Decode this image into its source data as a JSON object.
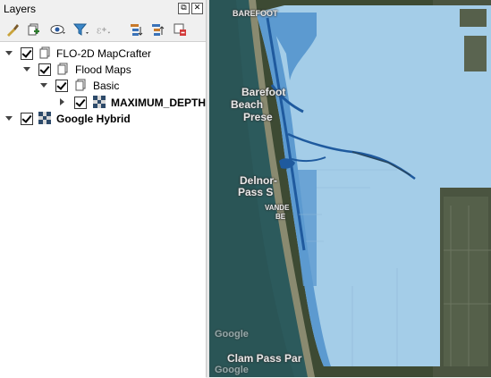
{
  "panel": {
    "title": "Layers",
    "header_buttons": {
      "float": "⧉",
      "close": "✕"
    },
    "toolbar_icons": [
      "style-manager-icon",
      "add-group-icon",
      "visibility-icon",
      "filter-icon",
      "filter-expression-icon",
      "expand-all-icon",
      "collapse-all-icon",
      "remove-layer-icon"
    ]
  },
  "tree": {
    "items": [
      {
        "label": "FLO-2D MapCrafter",
        "checked": true,
        "icon": "group-icon",
        "bold": false
      },
      {
        "label": "Flood Maps",
        "checked": true,
        "icon": "group-icon",
        "bold": false
      },
      {
        "label": "Basic",
        "checked": true,
        "icon": "group-icon",
        "bold": false
      },
      {
        "label": "MAXIMUM_DEPTH",
        "checked": true,
        "icon": "raster-icon",
        "bold": true
      },
      {
        "label": "Google Hybrid",
        "checked": true,
        "icon": "raster-icon",
        "bold": true
      }
    ]
  },
  "map": {
    "labels": [
      "BAREFOOT",
      "Barefoot",
      "Beach",
      "Prese",
      "Delnor-",
      "Pass S",
      "VANDE",
      "BE",
      "Clam Pass Par",
      "Google",
      "Google"
    ],
    "colors": {
      "land": "#3d4a33",
      "water": "#2c5a5c",
      "flood_light": "#a4cde8",
      "flood_mid": "#5c9ad0",
      "flood_dark": "#1f5a9e"
    }
  }
}
